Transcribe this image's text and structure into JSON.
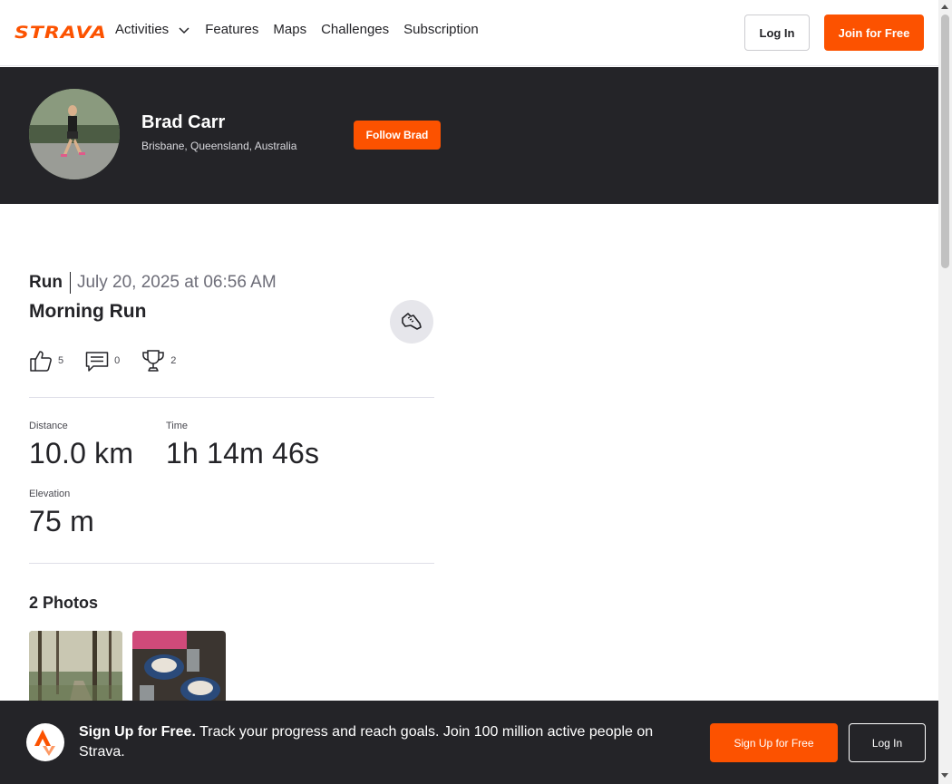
{
  "nav": {
    "logo": "STRAVA",
    "items": [
      {
        "label": "Activities"
      },
      {
        "label": "Features"
      },
      {
        "label": "Maps"
      },
      {
        "label": "Challenges"
      },
      {
        "label": "Subscription"
      }
    ],
    "login": "Log In",
    "join": "Join for Free"
  },
  "athlete": {
    "name": "Brad Carr",
    "location": "Brisbane, Queensland, Australia",
    "follow": "Follow Brad"
  },
  "activity": {
    "type": "Run",
    "date": "July 20, 2025 at 06:56 AM",
    "title": "Morning Run",
    "kudos": "5",
    "comments": "0",
    "achievements": "2",
    "stats": {
      "distance_label": "Distance",
      "distance_value": "10.0 km",
      "time_label": "Time",
      "time_value": "1h 14m 46s",
      "elevation_label": "Elevation",
      "elevation_value": "75 m"
    },
    "photos_title": "2 Photos"
  },
  "banner": {
    "bold": "Sign Up for Free.",
    "text": " Track your progress and reach goals. Join 100 million active people on Strava.",
    "signup": "Sign Up for Free",
    "login": "Log In"
  },
  "colors": {
    "brand": "#fc5200",
    "dark": "#242428"
  }
}
